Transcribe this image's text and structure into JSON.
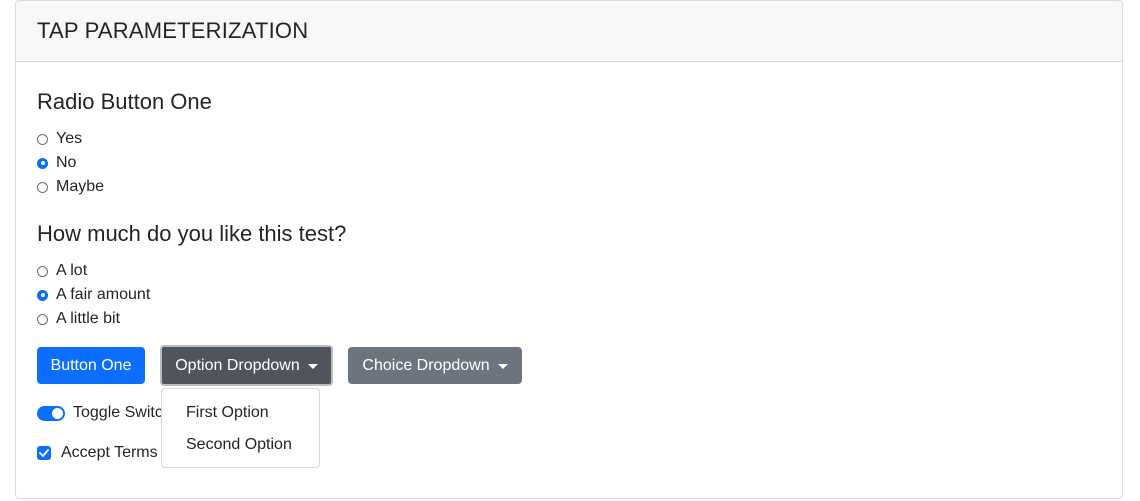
{
  "header": {
    "title": "TAP PARAMETERIZATION"
  },
  "section1": {
    "title": "Radio Button One",
    "options": [
      {
        "label": "Yes",
        "checked": false
      },
      {
        "label": "No",
        "checked": true
      },
      {
        "label": "Maybe",
        "checked": false
      }
    ]
  },
  "section2": {
    "title": "How much do you like this test?",
    "options": [
      {
        "label": "A lot",
        "checked": false
      },
      {
        "label": "A fair amount",
        "checked": true
      },
      {
        "label": "A little bit",
        "checked": false
      }
    ]
  },
  "buttons": {
    "button_one": "Button One",
    "option_dropdown": "Option Dropdown",
    "choice_dropdown": "Choice Dropdown"
  },
  "dropdown_menu": {
    "items": [
      "First Option",
      "Second Option"
    ]
  },
  "toggle": {
    "label": "Toggle Switch",
    "on": true
  },
  "terms": {
    "label": "Accept Terms",
    "checked": true
  },
  "colors": {
    "primary": "#0d6efd",
    "secondary": "#6c757d",
    "dark": "#4f555b"
  }
}
